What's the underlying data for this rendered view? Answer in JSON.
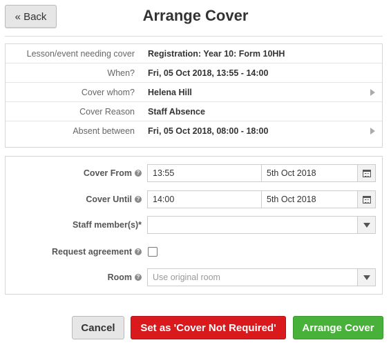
{
  "header": {
    "back_label": "« Back",
    "title": "Arrange Cover"
  },
  "info": {
    "rows": [
      {
        "label": "Lesson/event needing cover",
        "value": "Registration: Year 10: Form 10HH",
        "has_arrow": false
      },
      {
        "label": "When?",
        "value": "Fri, 05 Oct 2018, 13:55 - 14:00",
        "has_arrow": false
      },
      {
        "label": "Cover whom?",
        "value": "Helena Hill",
        "has_arrow": true
      },
      {
        "label": "Cover Reason",
        "value": "Staff Absence",
        "has_arrow": false
      },
      {
        "label": "Absent between",
        "value": "Fri, 05 Oct 2018, 08:00 - 18:00",
        "has_arrow": true
      }
    ]
  },
  "form": {
    "cover_from": {
      "label": "Cover From",
      "time": "13:55",
      "date": "5th Oct 2018"
    },
    "cover_until": {
      "label": "Cover Until",
      "time": "14:00",
      "date": "5th Oct 2018"
    },
    "staff": {
      "label": "Staff member(s)*",
      "value": ""
    },
    "request_agreement": {
      "label": "Request agreement",
      "checked": false
    },
    "room": {
      "label": "Room",
      "placeholder": "Use original room"
    }
  },
  "actions": {
    "cancel_label": "Cancel",
    "not_required_label": "Set as 'Cover Not Required'",
    "arrange_label": "Arrange Cover"
  },
  "colors": {
    "danger": "#d9191c",
    "success": "#48b13a",
    "neutral_button": "#e6e6e6"
  },
  "icons": {
    "help": "help-icon",
    "calendar": "calendar-icon",
    "dropdown": "chevron-down-icon",
    "row_arrow": "chevron-right-icon"
  }
}
